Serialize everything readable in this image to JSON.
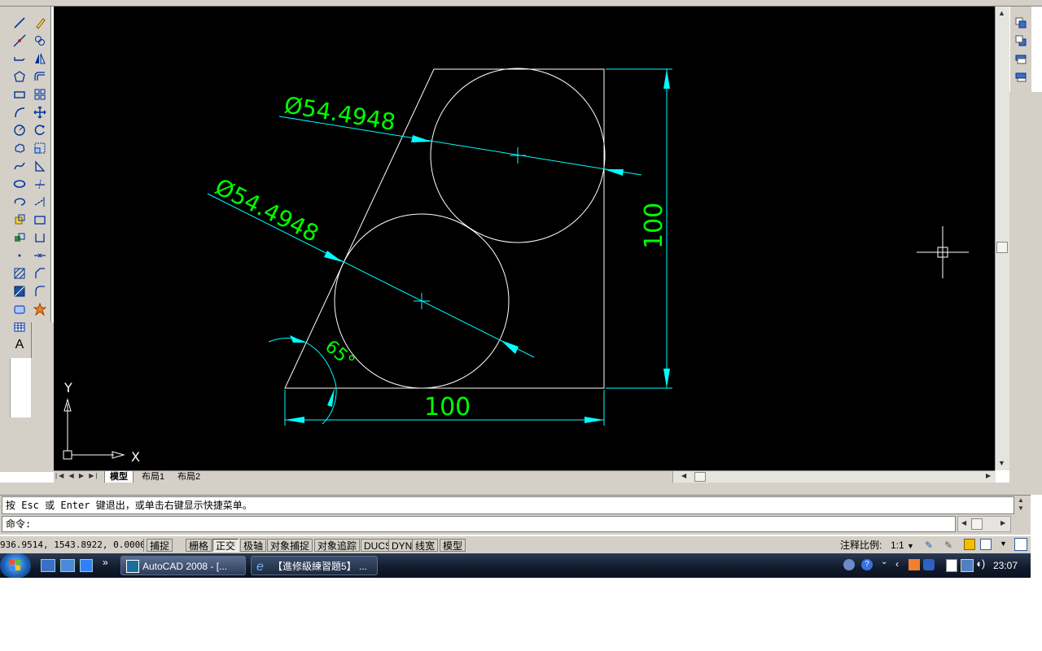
{
  "drawing": {
    "dim_diameter_1": "Ø54.4948",
    "dim_diameter_2": "Ø54.4948",
    "dim_angle": "65°",
    "dim_width": "100",
    "dim_height": "100",
    "ucs_x": "X",
    "ucs_y": "Y"
  },
  "layout_tabs": [
    "模型",
    "布局1",
    "布局2"
  ],
  "command": {
    "history_text": "按 Esc 或 Enter 键退出，或单击右键显示快捷菜单。",
    "prompt_label": "命令:",
    "input_value": ""
  },
  "status_bar": {
    "coordinates": "936.9514, 1543.8922, 0.0000",
    "toggles": [
      {
        "label": "捕捉",
        "on": false
      },
      {
        "label": "栅格",
        "on": false
      },
      {
        "label": "正交",
        "on": true
      },
      {
        "label": "极轴",
        "on": false
      },
      {
        "label": "对象捕捉",
        "on": false
      },
      {
        "label": "对象追踪",
        "on": false
      },
      {
        "label": "DUCS",
        "on": false
      },
      {
        "label": "DYN",
        "on": false
      },
      {
        "label": "线宽",
        "on": false
      },
      {
        "label": "模型",
        "on": false
      }
    ],
    "annotation_scale_label": "注释比例:",
    "annotation_scale_value": "1:1"
  },
  "taskbar": {
    "items": [
      "AutoCAD 2008 - [...",
      "【進修級練習題5】 ..."
    ],
    "clock": "23:07"
  },
  "colors": {
    "canvas_bg": "#000000",
    "geometry": "#ffffff",
    "dimension_lines": "#00ffff",
    "dimension_text": "#00ff00",
    "ui_gray": "#d4d0c8"
  }
}
